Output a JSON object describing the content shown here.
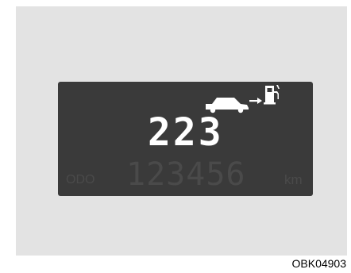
{
  "display": {
    "distance_to_empty": "223",
    "odometer_label": "ODO",
    "odometer_value": "123456",
    "odometer_unit": "km",
    "icons": [
      "car-icon",
      "arrow-to-fuel-icon",
      "fuel-pump-icon"
    ]
  },
  "caption": "OBK04903",
  "colors": {
    "lcd_background": "#3a3a3a",
    "lcd_active": "#ffffff",
    "lcd_dim": "#4a4a4a",
    "panel": "#e3e3e3"
  }
}
